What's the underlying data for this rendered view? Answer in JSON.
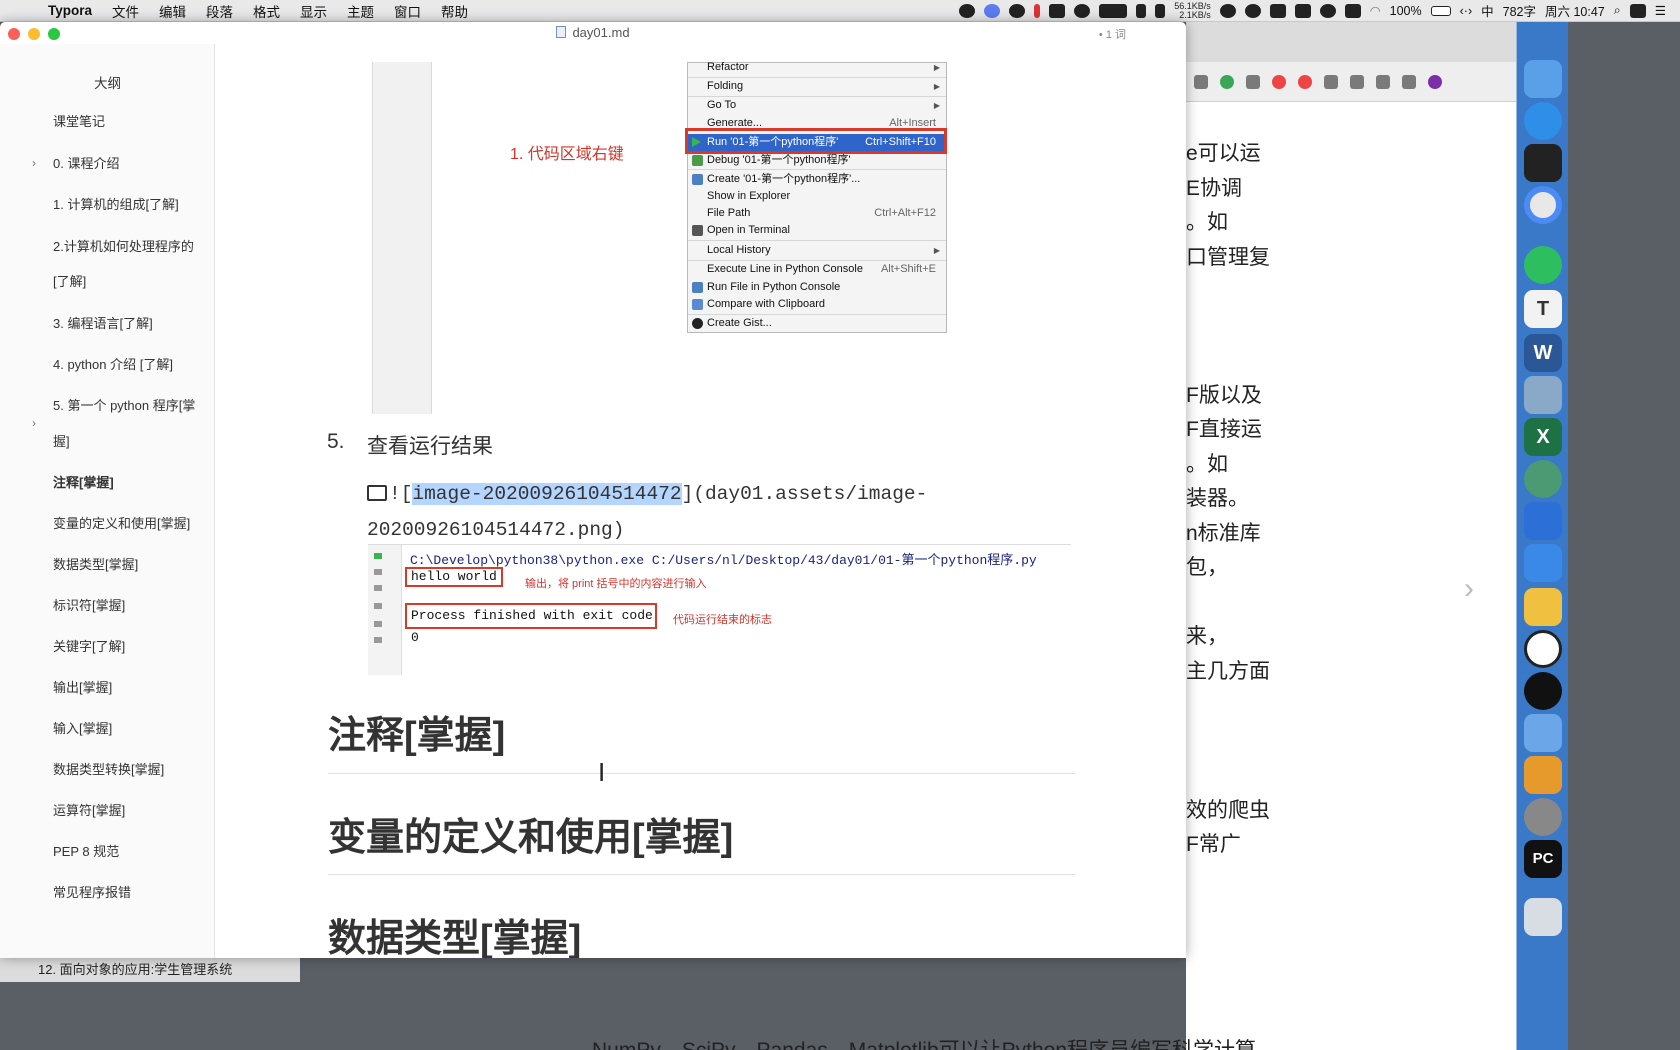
{
  "menubar": {
    "apple": "",
    "items": [
      "Typora",
      "文件",
      "编辑",
      "段落",
      "格式",
      "显示",
      "主题",
      "窗口",
      "帮助"
    ],
    "net_up": "56.1KB/s",
    "net_down": "2.1KB/s",
    "battery": "100%",
    "ime": "中",
    "word_status": "782字",
    "clock": "周六 10:47"
  },
  "window": {
    "title": "day01.md",
    "word_count": "• 1 词"
  },
  "sidebar": {
    "title": "大纲",
    "items": [
      {
        "label": "课堂笔记"
      },
      {
        "label": "0. 课程介绍"
      },
      {
        "label": "1. 计算机的组成[了解]"
      },
      {
        "label": "2.计算机如何处理程序的"
      },
      {
        "label": "[了解]"
      },
      {
        "label": "3. 编程语言[了解]"
      },
      {
        "label": "4. python 介绍 [了解]"
      },
      {
        "label": "5. 第一个 python 程序[掌"
      },
      {
        "label": "握]"
      },
      {
        "label": "注释[掌握]"
      },
      {
        "label": "变量的定义和使用[掌握]"
      },
      {
        "label": "数据类型[掌握]"
      },
      {
        "label": "标识符[掌握]"
      },
      {
        "label": "关键字[了解]"
      },
      {
        "label": "输出[掌握]"
      },
      {
        "label": "输入[掌握]"
      },
      {
        "label": "数据类型转换[掌握]"
      },
      {
        "label": "运算符[掌握]"
      },
      {
        "label": "PEP 8 规范"
      },
      {
        "label": "常见程序报错"
      }
    ]
  },
  "context_menu": {
    "annotation": "1. 代码区域右键",
    "items": [
      {
        "label": "Refactor",
        "shortcut": ""
      },
      {
        "label": "Folding",
        "shortcut": ""
      },
      {
        "label": "Go To",
        "shortcut": ""
      },
      {
        "label": "Generate...",
        "shortcut": "Alt+Insert"
      },
      {
        "label": "Run '01-第一个python程序'",
        "shortcut": "Ctrl+Shift+F10"
      },
      {
        "label": "Debug '01-第一个python程序'",
        "shortcut": ""
      },
      {
        "label": "Create '01-第一个python程序'...",
        "shortcut": ""
      },
      {
        "label": "Show in Explorer",
        "shortcut": ""
      },
      {
        "label": "File Path",
        "shortcut": "Ctrl+Alt+F12"
      },
      {
        "label": "Open in Terminal",
        "shortcut": ""
      },
      {
        "label": "Local History",
        "shortcut": ""
      },
      {
        "label": "Execute Line in Python Console",
        "shortcut": "Alt+Shift+E"
      },
      {
        "label": "Run File in Python Console",
        "shortcut": ""
      },
      {
        "label": "Compare with Clipboard",
        "shortcut": ""
      },
      {
        "label": "Create Gist...",
        "shortcut": ""
      }
    ]
  },
  "doc": {
    "list_num": "5.",
    "list_text": "查看运行结果",
    "img_prefix": "![",
    "img_alt": "image-20200926104514472",
    "img_suffix": "](day01.assets/image-20200926104514472.png)",
    "run_output": {
      "command": "C:\\Develop\\python38\\python.exe C:/Users/nl/Desktop/43/day01/01-第一个python程序.py",
      "hello": "hello world",
      "hello_note": "输出，将 print 括号中的内容进行输入",
      "finished": "Process finished with exit code 0",
      "finished_note": "代码运行结束的标志"
    },
    "headings": [
      "注释[掌握]",
      "变量的定义和使用[掌握]",
      "数据类型[掌握]"
    ]
  },
  "background_window": {
    "lines": [
      "e可以运",
      "E协调",
      "。如",
      "口管理复",
      "F版以及",
      "F直接运",
      "。如",
      "装器。",
      "n标准库",
      "包，",
      "来，",
      "主几方面",
      "效的爬虫",
      "F常广"
    ],
    "bottom_text": "NumPy、SciPy、Pandas、Matplotlib可以让Python程序员编写科学计算",
    "task_item": "12. 面向对象的应用:学生管理系统"
  }
}
